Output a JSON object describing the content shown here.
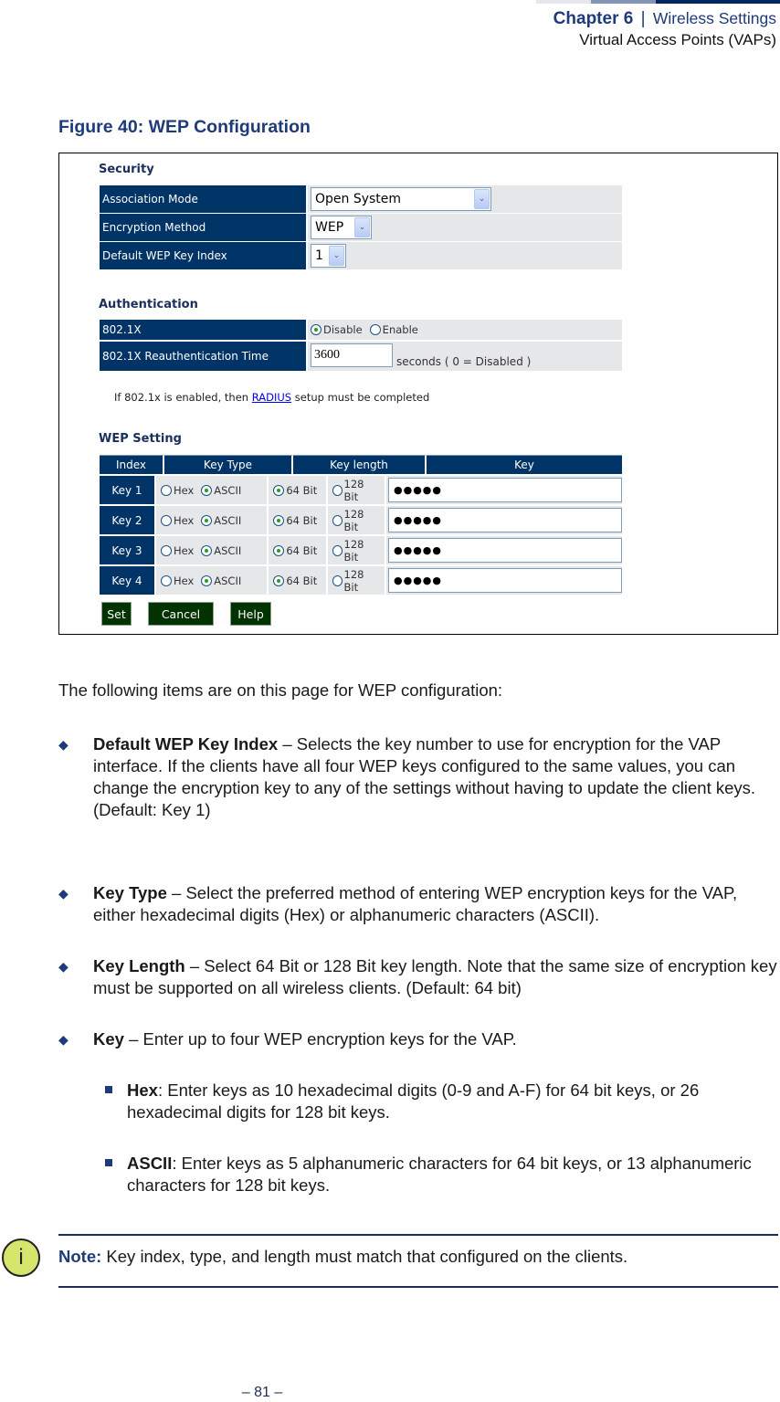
{
  "header": {
    "chapter": "Chapter 6",
    "separator": "|",
    "section": "Wireless Settings",
    "subsection": "Virtual Access Points (VAPs)",
    "bar_colors": [
      "#e4e7ec",
      "#8394b4",
      "#00285f"
    ]
  },
  "figure": {
    "title": "Figure 40:  WEP Configuration",
    "security": {
      "title": "Security",
      "association_mode": {
        "label": "Association Mode",
        "value": "Open System"
      },
      "encryption_method": {
        "label": "Encryption Method",
        "value": "WEP"
      },
      "default_key_index": {
        "label": "Default WEP Key Index",
        "value": "1"
      }
    },
    "authentication": {
      "title": "Authentication",
      "dot1x": {
        "label": "802.1X",
        "options": [
          "Disable",
          "Enable"
        ],
        "selected": "Disable"
      },
      "reauth": {
        "label": "802.1X Reauthentication Time",
        "value": "3600",
        "suffix": "seconds ( 0 = Disabled )"
      },
      "note_before": "If 802.1x is enabled, then ",
      "note_link": "RADIUS",
      "note_after": " setup must be completed"
    },
    "wep": {
      "title": "WEP Setting",
      "headers": {
        "index": "Index",
        "key_type": "Key Type",
        "key_length": "Key length",
        "key": "Key"
      },
      "type_options": [
        "Hex",
        "ASCII"
      ],
      "length_options": [
        "64 Bit",
        "128 Bit"
      ],
      "keys": [
        {
          "name": "Key 1",
          "type": "ASCII",
          "length": "64 Bit",
          "value": "●●●●●"
        },
        {
          "name": "Key 2",
          "type": "ASCII",
          "length": "64 Bit",
          "value": "●●●●●"
        },
        {
          "name": "Key 3",
          "type": "ASCII",
          "length": "64 Bit",
          "value": "●●●●●"
        },
        {
          "name": "Key 4",
          "type": "ASCII",
          "length": "64 Bit",
          "value": "●●●●●"
        }
      ]
    },
    "buttons": {
      "set": "Set",
      "cancel": "Cancel",
      "help": "Help"
    }
  },
  "body": {
    "intro": "The following items are on this page for WEP configuration:",
    "bullets": [
      {
        "term": "Default WEP Key Index",
        "desc": " – Selects the key number to use for encryption for the VAP interface. If the clients have all four WEP keys configured to the same values, you can change the encryption key to any of the settings without having to update the client keys.",
        "default": "(Default: Key 1)"
      },
      {
        "term": "Key Type",
        "desc": " – Select the preferred method of entering WEP encryption keys for the VAP, either hexadecimal digits (Hex) or alphanumeric characters (ASCII)."
      },
      {
        "term": "Key Length",
        "desc": " – Select 64 Bit or 128 Bit key length. Note that the same size of encryption key must be supported on all wireless clients. (Default: 64 bit)"
      },
      {
        "term": "Key",
        "desc": " – Enter up to four WEP encryption keys for the VAP."
      }
    ],
    "sub_bullets": [
      {
        "term": "Hex",
        "desc": ": Enter keys as 10 hexadecimal digits (0-9 and A-F) for 64 bit keys, or 26 hexadecimal digits for 128 bit keys."
      },
      {
        "term": "ASCII",
        "desc": ": Enter keys as 5 alphanumeric characters for 64 bit keys, or 13 alphanumeric characters for 128 bit keys."
      }
    ],
    "note": {
      "label": "Note:",
      "text": " Key index, type, and length must match that configured on the clients.",
      "icon_glyph": "i"
    }
  },
  "footer": {
    "page": "–  81  –"
  }
}
